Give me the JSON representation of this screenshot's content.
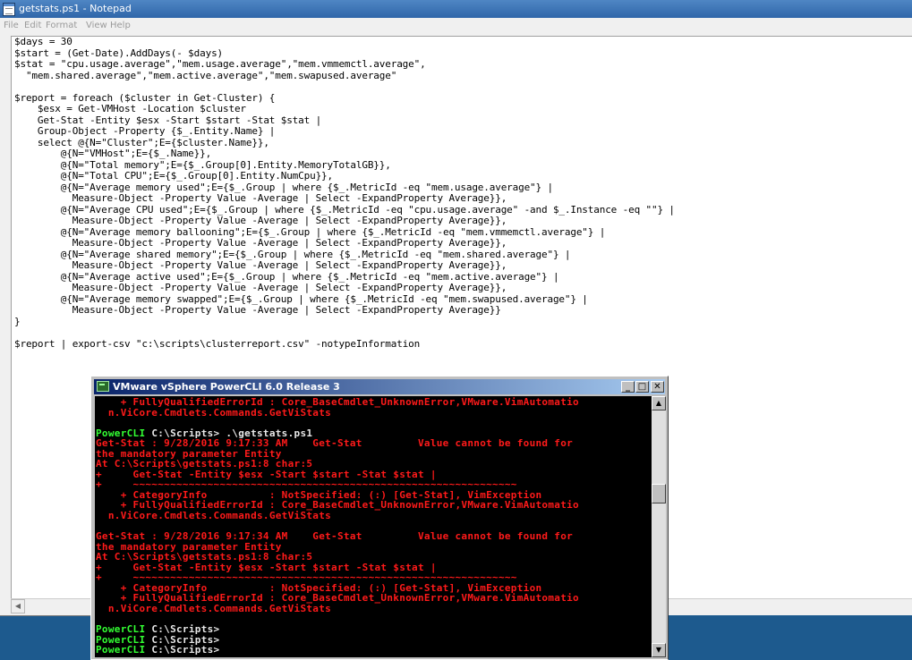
{
  "notepad": {
    "title": "getstats.ps1 - Notepad",
    "menu": [
      "File",
      "Edit",
      "Format",
      "View",
      "Help"
    ],
    "content": "$days = 30\n$start = (Get-Date).AddDays(- $days)\n$stat = \"cpu.usage.average\",\"mem.usage.average\",\"mem.vmmemctl.average\",\n  \"mem.shared.average\",\"mem.active.average\",\"mem.swapused.average\"\n\n$report = foreach ($cluster in Get-Cluster) {\n    $esx = Get-VMHost -Location $cluster\n    Get-Stat -Entity $esx -Start $start -Stat $stat |\n    Group-Object -Property {$_.Entity.Name} |\n    select @{N=\"Cluster\";E={$cluster.Name}},\n        @{N=\"VMHost\";E={$_.Name}},\n        @{N=\"Total memory\";E={$_.Group[0].Entity.MemoryTotalGB}},\n        @{N=\"Total CPU\";E={$_.Group[0].Entity.NumCpu}},\n        @{N=\"Average memory used\";E={$_.Group | where {$_.MetricId -eq \"mem.usage.average\"} |\n          Measure-Object -Property Value -Average | Select -ExpandProperty Average}},\n        @{N=\"Average CPU used\";E={$_.Group | where {$_.MetricId -eq \"cpu.usage.average\" -and $_.Instance -eq \"\"} |\n          Measure-Object -Property Value -Average | Select -ExpandProperty Average}},\n        @{N=\"Average memory ballooning\";E={$_.Group | where {$_.MetricId -eq \"mem.vmmemctl.average\"} |\n          Measure-Object -Property Value -Average | Select -ExpandProperty Average}},\n        @{N=\"Average shared memory\";E={$_.Group | where {$_.MetricId -eq \"mem.shared.average\"} |\n          Measure-Object -Property Value -Average | Select -ExpandProperty Average}},\n        @{N=\"Average active used\";E={$_.Group | where {$_.MetricId -eq \"mem.active.average\"} |\n          Measure-Object -Property Value -Average | Select -ExpandProperty Average}},\n        @{N=\"Average memory swapped\";E={$_.Group | where {$_.MetricId -eq \"mem.swapused.average\"} |\n          Measure-Object -Property Value -Average | Select -ExpandProperty Average}}\n}\n\n$report | export-csv \"c:\\scripts\\clusterreport.csv\" -notypeInformation"
  },
  "powercli": {
    "title": "VMware vSphere PowerCLI 6.0 Release 3",
    "buttons": {
      "minimize": "_",
      "maximize": "□",
      "close": "✕"
    },
    "lines": [
      {
        "t": "    + FullyQualifiedErrorId : Core_BaseCmdlet_UnknownError,VMware.VimAutomatio",
        "c": "red"
      },
      {
        "t": "  n.ViCore.Cmdlets.Commands.GetViStats",
        "c": "red"
      },
      {
        "t": "",
        "c": "red"
      },
      {
        "t": "PowerCLI C:\\Scripts> .\\getstats.ps1",
        "c": "prompt"
      },
      {
        "t": "Get-Stat : 9/28/2016 9:17:33 AM    Get-Stat         Value cannot be found for",
        "c": "red"
      },
      {
        "t": "the mandatory parameter Entity",
        "c": "red"
      },
      {
        "t": "At C:\\Scripts\\getstats.ps1:8 char:5",
        "c": "red"
      },
      {
        "t": "+     Get-Stat -Entity $esx -Start $start -Stat $stat |",
        "c": "red"
      },
      {
        "t": "+     ~~~~~~~~~~~~~~~~~~~~~~~~~~~~~~~~~~~~~~~~~~~~~~~~~~~~~~~~~~~~~~",
        "c": "red"
      },
      {
        "t": "    + CategoryInfo          : NotSpecified: (:) [Get-Stat], VimException",
        "c": "red"
      },
      {
        "t": "    + FullyQualifiedErrorId : Core_BaseCmdlet_UnknownError,VMware.VimAutomatio",
        "c": "red"
      },
      {
        "t": "  n.ViCore.Cmdlets.Commands.GetViStats",
        "c": "red"
      },
      {
        "t": "",
        "c": "red"
      },
      {
        "t": "Get-Stat : 9/28/2016 9:17:34 AM    Get-Stat         Value cannot be found for",
        "c": "red"
      },
      {
        "t": "the mandatory parameter Entity",
        "c": "red"
      },
      {
        "t": "At C:\\Scripts\\getstats.ps1:8 char:5",
        "c": "red"
      },
      {
        "t": "+     Get-Stat -Entity $esx -Start $start -Stat $stat |",
        "c": "red"
      },
      {
        "t": "+     ~~~~~~~~~~~~~~~~~~~~~~~~~~~~~~~~~~~~~~~~~~~~~~~~~~~~~~~~~~~~~~",
        "c": "red"
      },
      {
        "t": "    + CategoryInfo          : NotSpecified: (:) [Get-Stat], VimException",
        "c": "red"
      },
      {
        "t": "    + FullyQualifiedErrorId : Core_BaseCmdlet_UnknownError,VMware.VimAutomatio",
        "c": "red"
      },
      {
        "t": "  n.ViCore.Cmdlets.Commands.GetViStats",
        "c": "red"
      },
      {
        "t": "",
        "c": "red"
      },
      {
        "t": "PowerCLI C:\\Scripts>",
        "c": "prompt"
      },
      {
        "t": "PowerCLI C:\\Scripts>",
        "c": "prompt"
      },
      {
        "t": "PowerCLI C:\\Scripts>",
        "c": "prompt"
      }
    ]
  },
  "colors": {
    "desktop": "#1d5a8e",
    "console_background": "#000000",
    "error_text": "#ff1a1a",
    "prompt_text": "#33ff33"
  }
}
